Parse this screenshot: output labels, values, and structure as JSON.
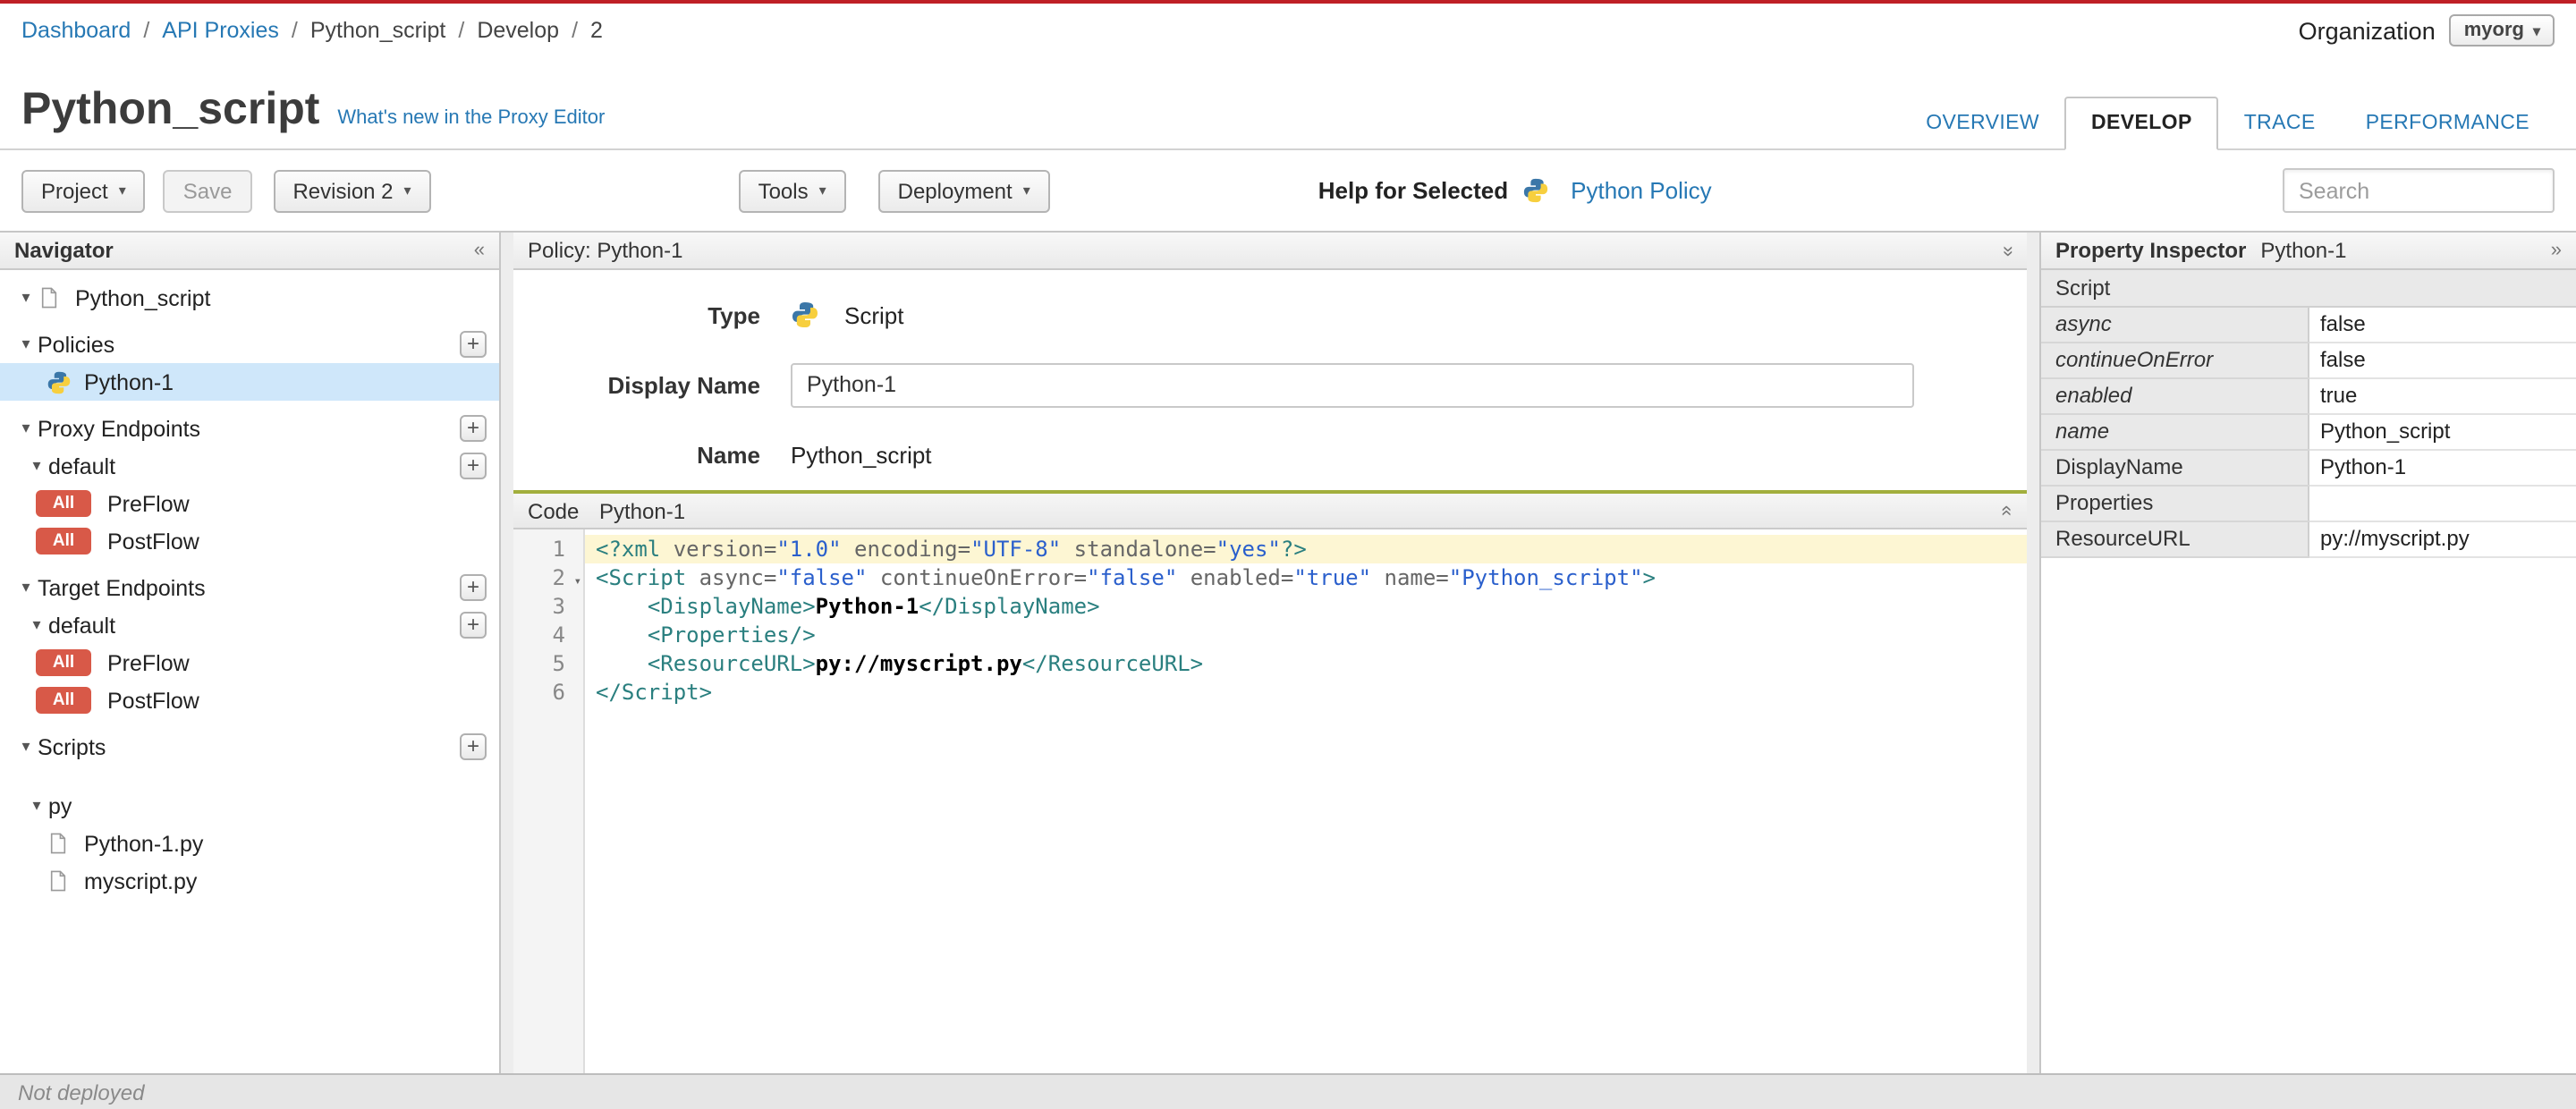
{
  "icons": {
    "caret_down": "▾",
    "collapse_left": "«",
    "collapse_right": "»",
    "chevrons": "»",
    "plus": "+",
    "fold": "▾",
    "sep": "/"
  },
  "topbar": {
    "breadcrumb": [
      "Dashboard",
      "API Proxies",
      "Python_script",
      "Develop",
      "2"
    ],
    "organization_label": "Organization",
    "organization_value": "myorg"
  },
  "header": {
    "title": "Python_script",
    "whats_new_link": "What's new in the Proxy Editor",
    "tabs": [
      {
        "label": "OVERVIEW"
      },
      {
        "label": "DEVELOP"
      },
      {
        "label": "TRACE"
      },
      {
        "label": "PERFORMANCE"
      }
    ]
  },
  "toolbar": {
    "project": "Project",
    "save": "Save",
    "revision": "Revision 2",
    "tools": "Tools",
    "deployment": "Deployment",
    "help_for_selected": "Help for Selected",
    "policy_link": "Python Policy",
    "search_placeholder": "Search"
  },
  "navigator": {
    "title": "Navigator",
    "items": [
      {
        "label": "Python_script"
      },
      {
        "label": "Policies"
      },
      {
        "label": "Python-1"
      },
      {
        "label": "Proxy Endpoints"
      },
      {
        "label": "default"
      },
      {
        "badge": "All",
        "label": "PreFlow"
      },
      {
        "badge": "All",
        "label": "PostFlow"
      },
      {
        "label": "Target Endpoints"
      },
      {
        "label": "default"
      },
      {
        "badge": "All",
        "label": "PreFlow"
      },
      {
        "badge": "All",
        "label": "PostFlow"
      },
      {
        "label": "Scripts"
      },
      {
        "label": "py"
      },
      {
        "label": "Python-1.py"
      },
      {
        "label": "myscript.py"
      }
    ]
  },
  "policy": {
    "pane_title": "Policy: Python-1",
    "type_label": "Type",
    "type_value": "Script",
    "display_name_label": "Display Name",
    "display_name_value": "Python-1",
    "name_label": "Name",
    "name_value": "Python_script"
  },
  "code": {
    "tab": "Code",
    "title": "Python-1",
    "lines": [
      {
        "num": "1",
        "active": true,
        "tokens": [
          [
            "tag",
            "<?xml"
          ],
          [
            "attr",
            " version="
          ],
          [
            "str",
            "\"1.0\""
          ],
          [
            "attr",
            " encoding="
          ],
          [
            "str",
            "\"UTF-8\""
          ],
          [
            "attr",
            " standalone="
          ],
          [
            "str",
            "\"yes\""
          ],
          [
            "tag",
            "?>"
          ]
        ]
      },
      {
        "num": "2",
        "fold": true,
        "tokens": [
          [
            "tag",
            "<Script"
          ],
          [
            "attr",
            " async="
          ],
          [
            "str",
            "\"false\""
          ],
          [
            "attr",
            " continueOnError="
          ],
          [
            "str",
            "\"false\""
          ],
          [
            "attr",
            " enabled="
          ],
          [
            "str",
            "\"true\""
          ],
          [
            "attr",
            " name="
          ],
          [
            "str",
            "\"Python_script\""
          ],
          [
            "tag",
            ">"
          ]
        ]
      },
      {
        "num": "3",
        "tokens": [
          [
            "plain",
            "    "
          ],
          [
            "tag",
            "<DisplayName>"
          ],
          [
            "text",
            "Python-1"
          ],
          [
            "tag",
            "</DisplayName>"
          ]
        ]
      },
      {
        "num": "4",
        "tokens": [
          [
            "plain",
            "    "
          ],
          [
            "tag",
            "<Properties/>"
          ]
        ]
      },
      {
        "num": "5",
        "tokens": [
          [
            "plain",
            "    "
          ],
          [
            "tag",
            "<ResourceURL>"
          ],
          [
            "text",
            "py://myscript.py"
          ],
          [
            "tag",
            "</ResourceURL>"
          ]
        ]
      },
      {
        "num": "6",
        "tokens": [
          [
            "tag",
            "</Script>"
          ]
        ]
      }
    ]
  },
  "inspector": {
    "title": "Property Inspector",
    "subtitle": "Python-1",
    "section": "Script",
    "rows": [
      {
        "name": "async",
        "value": "false"
      },
      {
        "name": "continueOnError",
        "value": "false"
      },
      {
        "name": "enabled",
        "value": "true"
      },
      {
        "name": "name",
        "value": "Python_script"
      },
      {
        "name": "DisplayName",
        "value": "Python-1"
      },
      {
        "name": "Properties",
        "value": ""
      },
      {
        "name": "ResourceURL",
        "value": "py://myscript.py"
      }
    ]
  },
  "statusbar": {
    "text": "Not deployed"
  }
}
